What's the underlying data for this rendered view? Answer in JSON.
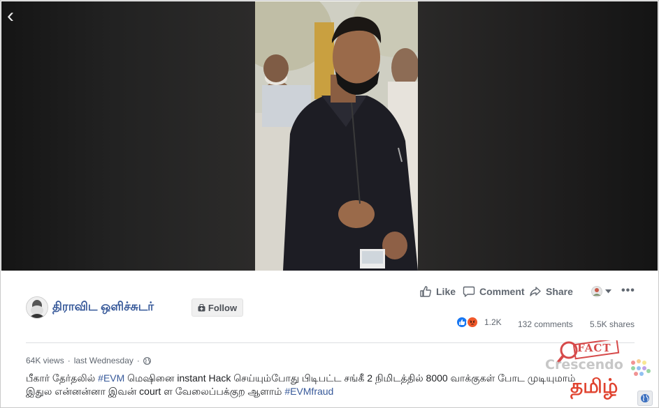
{
  "video": {
    "back_icon": "chevron-left-icon"
  },
  "post": {
    "page_name": "திராவிட ஒளிச்சுடர்",
    "follow_label": "Follow",
    "actions": {
      "like_label": "Like",
      "comment_label": "Comment",
      "share_label": "Share"
    },
    "stats": {
      "reaction_icons": [
        "like-reaction-icon",
        "angry-reaction-icon"
      ],
      "reactions_count": "1.2K",
      "comments_count": "132 comments",
      "shares_count": "5.5K shares"
    },
    "meta": {
      "views": "64K views",
      "separator": "·",
      "time": "last Wednesday",
      "separator2": "·",
      "privacy_icon": "globe-icon"
    },
    "caption": {
      "part1": "பீகார் தேர்தலில் ",
      "hashtag1": "#EVM",
      "part2": " மெஷினை instant Hack செய்யும்போது பிடிபட்ட சங்கீ 2 நிமிடத்தில் 8000 வாக்குகள் போட முடியுமாம் இதுல என்னன்னா இவன் court ள வேலைப்பக்குற ஆளாம் ",
      "hashtag2": "#EVMfraud"
    }
  },
  "watermark": {
    "fact": "FACT",
    "brand": "Crescendo",
    "language": "தமிழ்"
  },
  "colors": {
    "link_blue": "#365899",
    "text_gray": "#606770",
    "like_blue": "#1877f2",
    "angry_orange": "#f0582a",
    "watermark_red": "#e0432f"
  }
}
